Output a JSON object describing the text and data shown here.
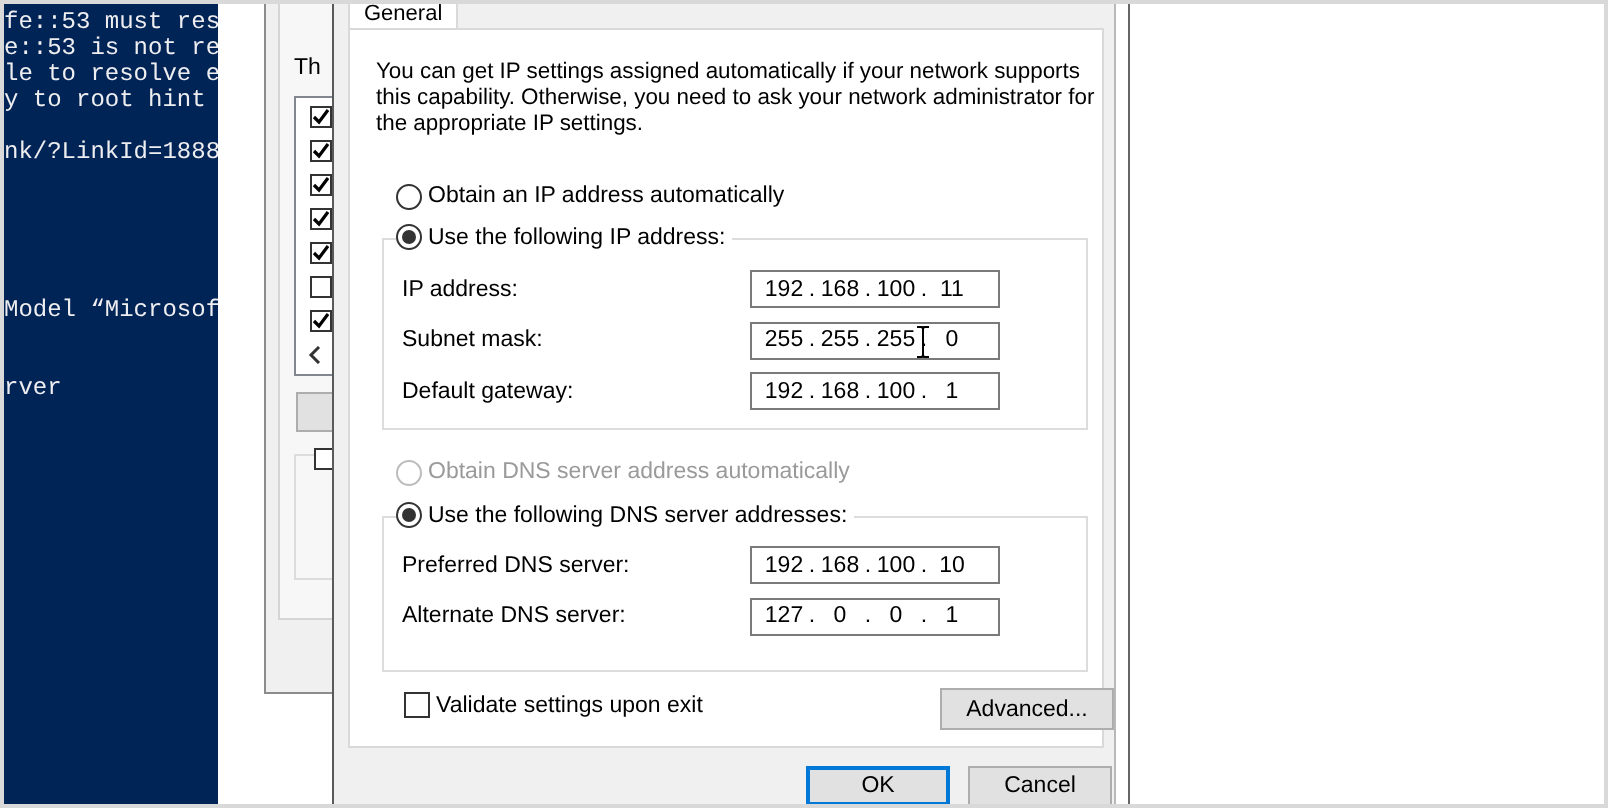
{
  "terminal": {
    "lines": [
      "fe::53 must res",
      "e::53 is not re",
      "le to resolve e",
      "y to root hint ",
      "nk/?LinkId=1888",
      "Model “Microsof",
      "rver"
    ]
  },
  "back_dialog": {
    "label_fragment": "Th",
    "list_items": [
      {
        "checked": true
      },
      {
        "checked": true
      },
      {
        "checked": true
      },
      {
        "checked": true
      },
      {
        "checked": true
      },
      {
        "checked": false
      },
      {
        "checked": true
      }
    ],
    "option_checkbox": {
      "checked": false
    }
  },
  "dialog": {
    "tab": {
      "label": "General",
      "selected": true
    },
    "description": "You can get IP settings assigned automatically if your network supports this capability. Otherwise, you need to ask your network administrator for the appropriate IP settings.",
    "ip_options": [
      {
        "label": "Obtain an IP address automatically",
        "selected": false,
        "disabled": false
      },
      {
        "label": "Use the following IP address:",
        "selected": true,
        "disabled": false
      }
    ],
    "ip_fields": [
      {
        "label": "IP address:",
        "value": "192 . 168 . 100 . 11"
      },
      {
        "label": "Subnet mask:",
        "value": "255 . 255 . 255 . 0"
      },
      {
        "label": "Default gateway:",
        "value": "192 . 168 . 100 . 1"
      }
    ],
    "dns_options": [
      {
        "label": "Obtain DNS server address automatically",
        "selected": false,
        "disabled": true
      },
      {
        "label": "Use the following DNS server addresses:",
        "selected": true,
        "disabled": false
      }
    ],
    "dns_fields": [
      {
        "label": "Preferred DNS server:",
        "value": "192 . 168 . 100 . 10"
      },
      {
        "label": "Alternate DNS server:",
        "value": "127 . 0 . 0 . 1"
      }
    ],
    "validate": {
      "label": "Validate settings upon exit",
      "checked": false
    },
    "advanced_button": "Advanced...",
    "buttons": [
      {
        "label": "OK",
        "default": true
      },
      {
        "label": "Cancel",
        "default": false
      }
    ]
  }
}
